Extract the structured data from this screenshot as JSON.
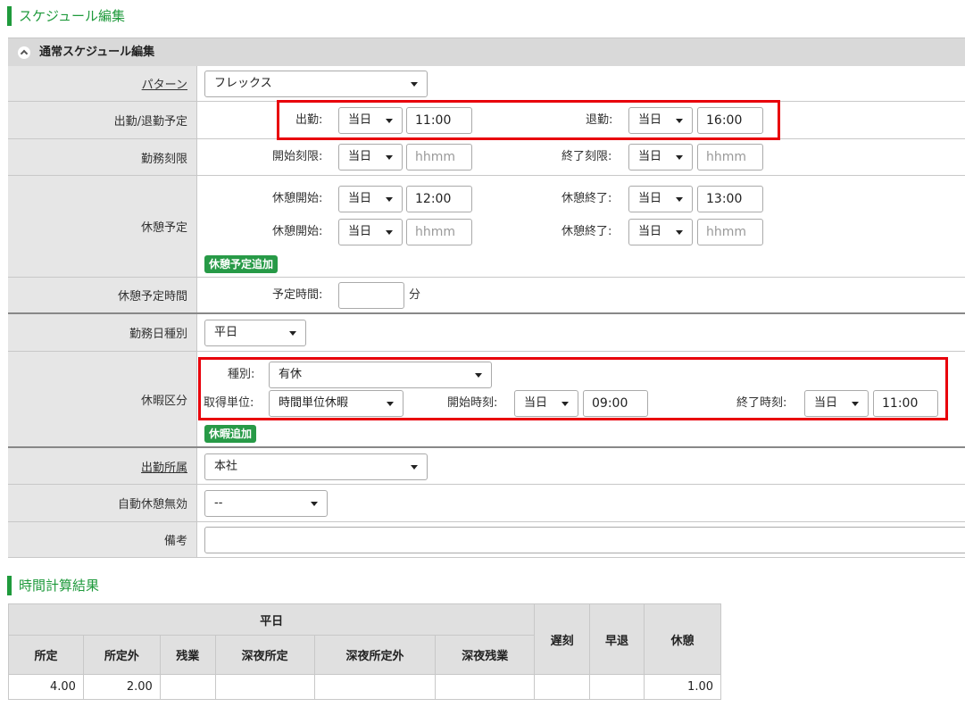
{
  "page": {
    "title": "スケジュール編集",
    "panel_title": "通常スケジュール編集"
  },
  "rows": {
    "pattern": {
      "label": "パターン",
      "value": "フレックス"
    },
    "attendance": {
      "label": "出勤/退勤予定",
      "start_label": "出勤:",
      "start_day": "当日",
      "start_time": "11:00",
      "end_label": "退勤:",
      "end_day": "当日",
      "end_time": "16:00"
    },
    "work_limit": {
      "label": "勤務刻限",
      "start_label": "開始刻限:",
      "start_day": "当日",
      "start_placeholder": "hhmm",
      "end_label": "終了刻限:",
      "end_day": "当日",
      "end_placeholder": "hhmm"
    },
    "break_plan": {
      "label": "休憩予定",
      "entries": [
        {
          "start_label": "休憩開始:",
          "start_day": "当日",
          "start_time": "12:00",
          "end_label": "休憩終了:",
          "end_day": "当日",
          "end_time": "13:00"
        },
        {
          "start_label": "休憩開始:",
          "start_day": "当日",
          "start_time": "hhmm",
          "end_label": "休憩終了:",
          "end_day": "当日",
          "end_time": "hhmm"
        }
      ],
      "add_button": "休憩予定追加"
    },
    "break_time": {
      "label": "休憩予定時間",
      "field_label": "予定時間:",
      "value": "",
      "unit": "分"
    },
    "workday_type": {
      "label": "勤務日種別",
      "value": "平日"
    },
    "leave": {
      "label": "休暇区分",
      "type_label": "種別:",
      "type_value": "有休",
      "unit_label": "取得単位:",
      "unit_value": "時間単位休暇",
      "start_label": "開始時刻:",
      "start_day": "当日",
      "start_time": "09:00",
      "end_label": "終了時刻:",
      "end_day": "当日",
      "end_time": "11:00",
      "add_button": "休暇追加"
    },
    "office": {
      "label": "出勤所属",
      "value": "本社"
    },
    "auto_break": {
      "label": "自動休憩無効",
      "value": "--"
    },
    "remarks": {
      "label": "備考",
      "value": ""
    }
  },
  "result": {
    "title": "時間計算結果",
    "group_header": "平日",
    "headers": [
      "所定",
      "所定外",
      "残業",
      "深夜所定",
      "深夜所定外",
      "深夜残業",
      "遅刻",
      "早退",
      "休憩"
    ],
    "values": [
      "4.00",
      "2.00",
      "",
      "",
      "",
      "",
      "",
      "",
      "1.00"
    ]
  },
  "colors": {
    "accent": "#1f9a3c",
    "highlight": "#e8000b",
    "label_bg": "#e6e6e6"
  }
}
